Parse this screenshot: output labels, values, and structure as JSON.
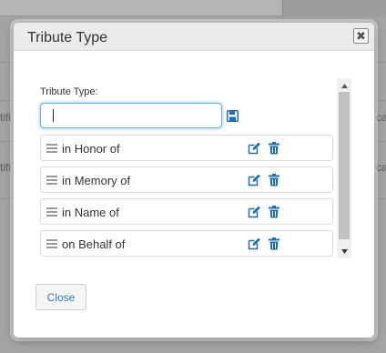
{
  "background": {
    "fragment_left_1": "tifi",
    "fragment_right_1": "ca",
    "fragment_left_2": "tifi",
    "fragment_right_2": "ca"
  },
  "modal": {
    "title": "Tribute Type",
    "close_glyph": "✖",
    "field_label": "Tribute Type:",
    "input_value": "",
    "items": [
      {
        "label": "in Honor of"
      },
      {
        "label": "in Memory of"
      },
      {
        "label": "in Name of"
      },
      {
        "label": "on Behalf of"
      }
    ],
    "close_button_label": "Close"
  },
  "colors": {
    "accent_blue": "#1f6fad",
    "input_focus": "#66afe9",
    "link_blue": "#337ab7"
  },
  "icons": {
    "save": "save-icon",
    "edit": "edit-icon",
    "delete": "trash-icon",
    "drag": "drag-handle-icon"
  }
}
